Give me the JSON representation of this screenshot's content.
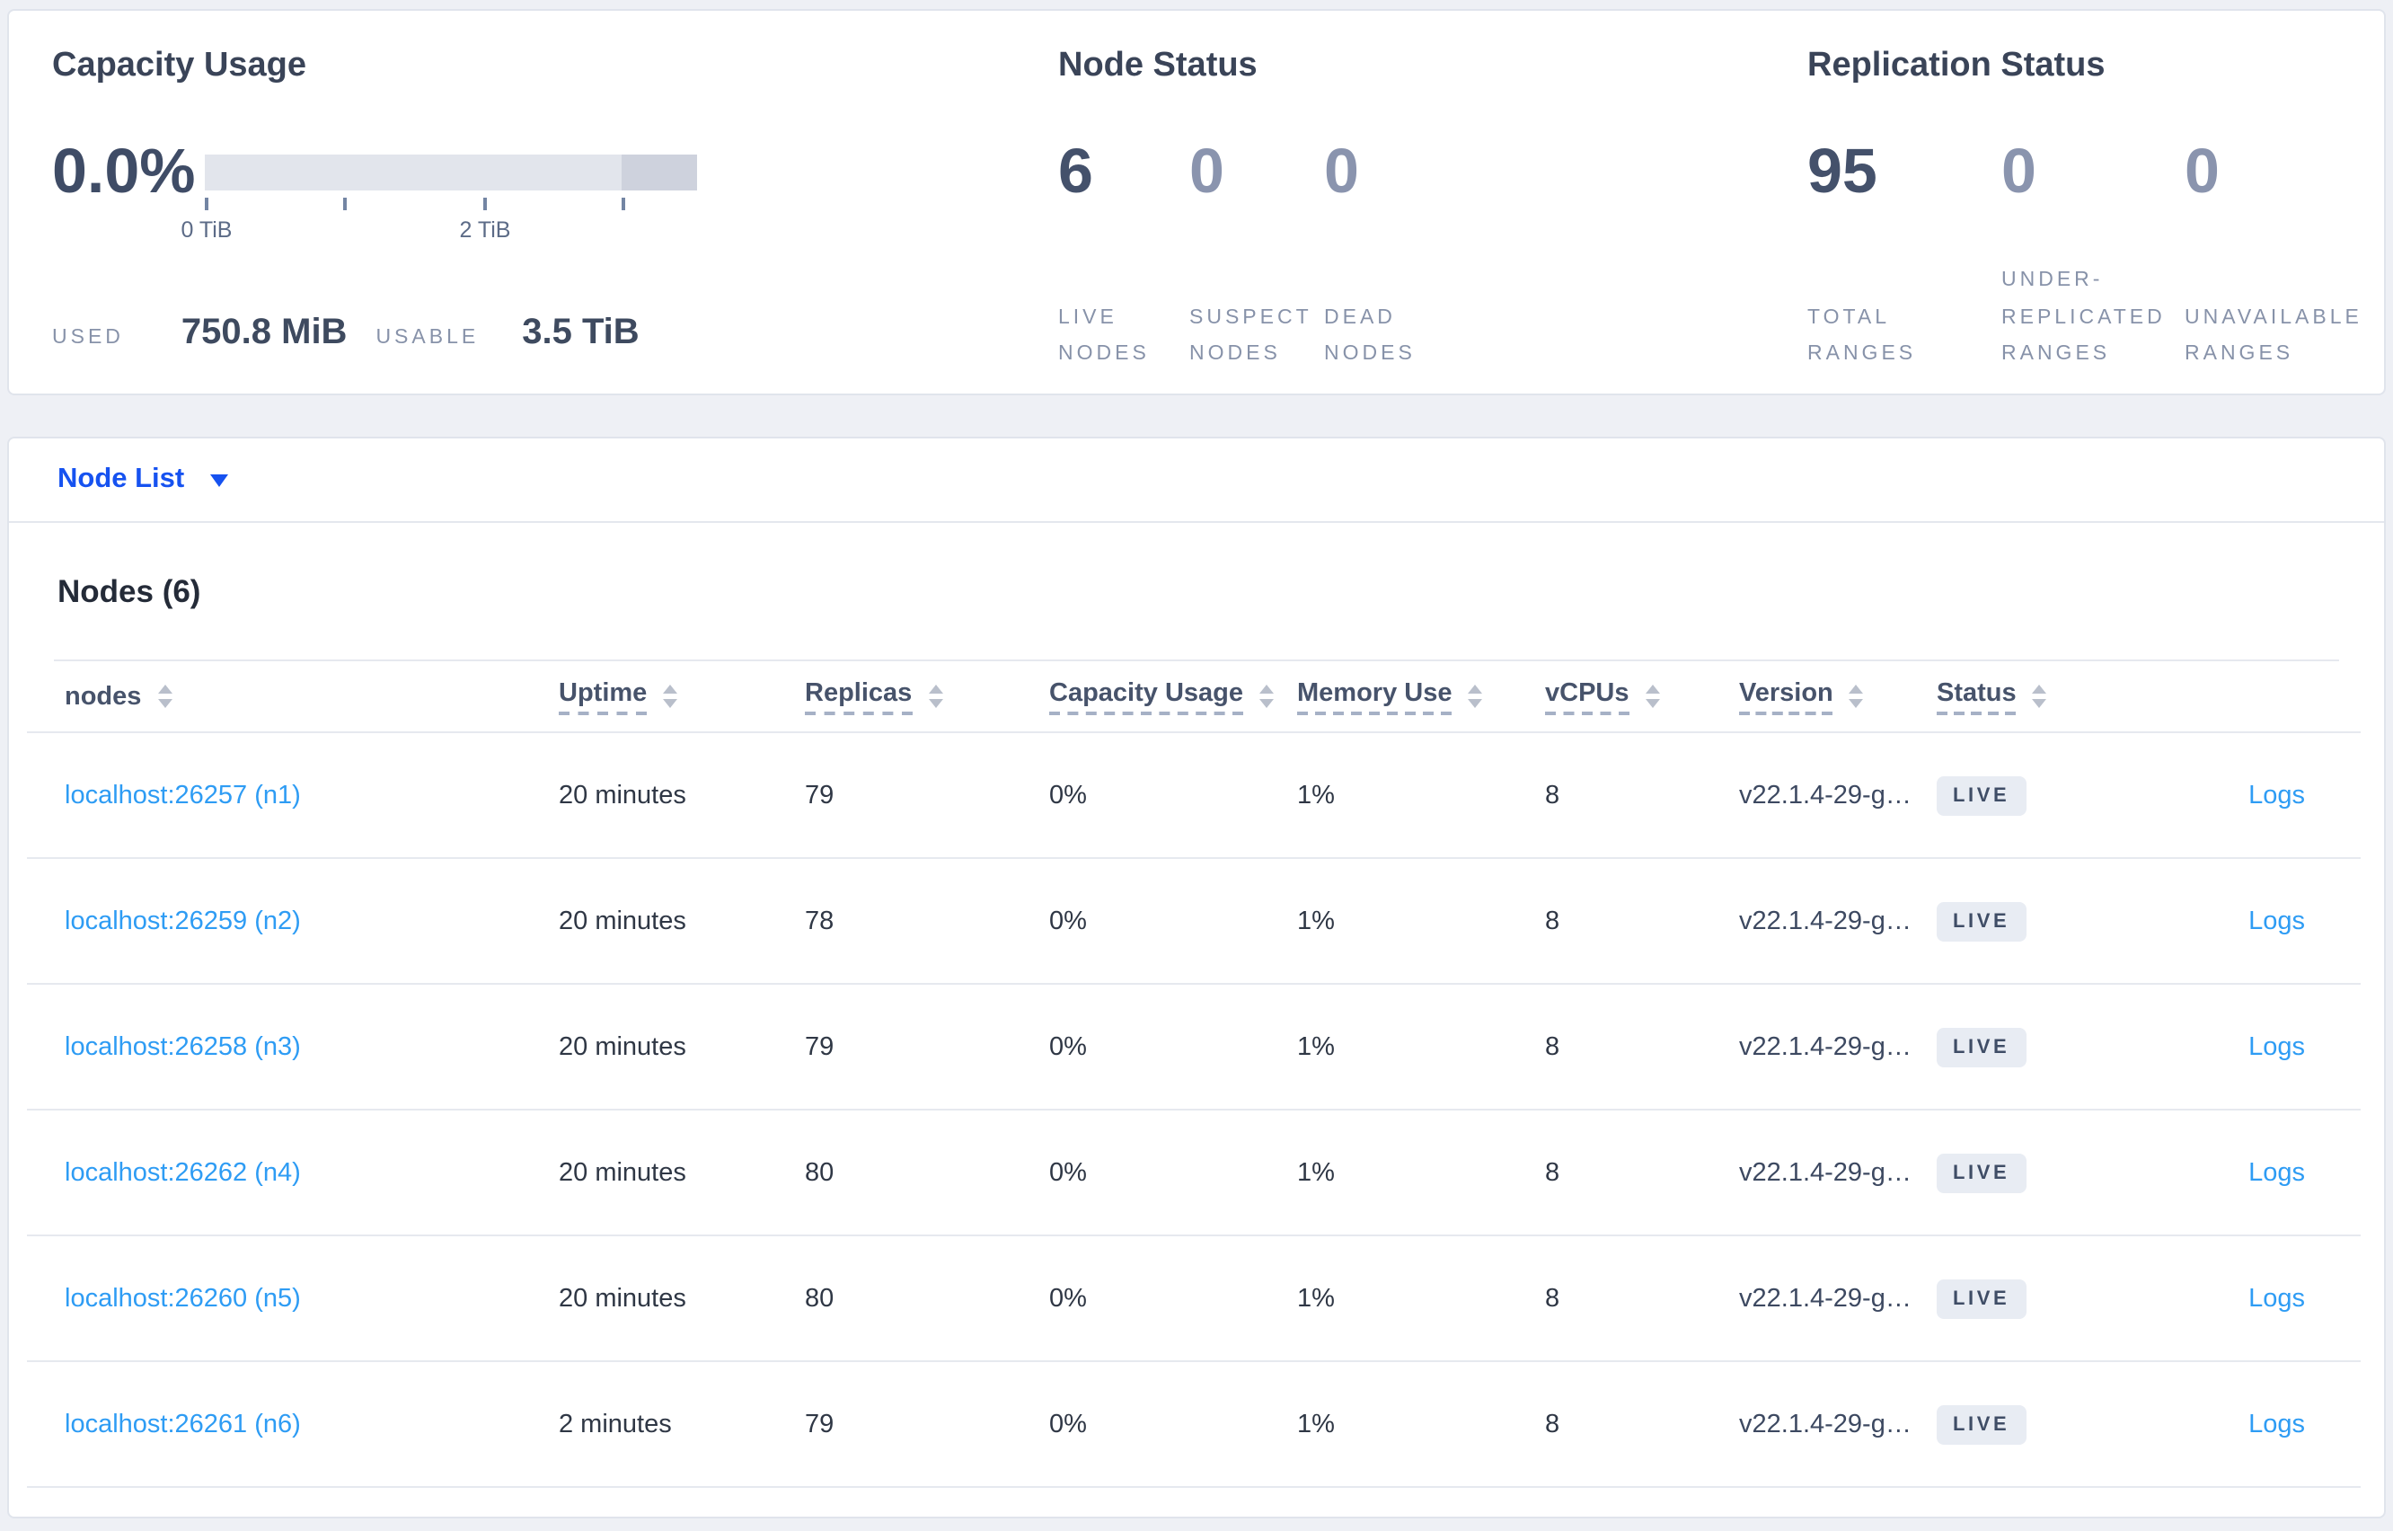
{
  "colors": {
    "selector_link_blue": "#1652f0",
    "row_link_blue": "#2e9cf4",
    "badge_bg": "#e8ecf3",
    "bar_fill_light": "#e2e5ec",
    "bar_fill_dark": "#ced2dd"
  },
  "summary": {
    "capacity": {
      "title": "Capacity Usage",
      "percent": "0.0%",
      "tick_labels": [
        "0 TiB",
        "2 TiB"
      ],
      "used_label": "USED",
      "used_value": "750.8 MiB",
      "usable_label": "USABLE",
      "usable_value": "3.5 TiB"
    },
    "node_status": {
      "title": "Node Status",
      "stats": [
        {
          "value": "6",
          "label": "LIVE NODES"
        },
        {
          "value": "0",
          "label": "SUSPECT NODES"
        },
        {
          "value": "0",
          "label": "DEAD NODES"
        }
      ]
    },
    "replication": {
      "title": "Replication Status",
      "stats": [
        {
          "value": "95",
          "label": "TOTAL RANGES"
        },
        {
          "value": "0",
          "label": "UNDER-REPLICATED RANGES"
        },
        {
          "value": "0",
          "label": "UNAVAILABLE RANGES"
        }
      ]
    }
  },
  "view_selector": {
    "label": "Node List"
  },
  "table": {
    "title": "Nodes (6)",
    "columns": [
      {
        "label": "nodes"
      },
      {
        "label": "Uptime"
      },
      {
        "label": "Replicas"
      },
      {
        "label": "Capacity Usage"
      },
      {
        "label": "Memory Use"
      },
      {
        "label": "vCPUs"
      },
      {
        "label": "Version"
      },
      {
        "label": "Status"
      }
    ],
    "rows": [
      {
        "address": "localhost:26257 (n1)",
        "uptime": "20 minutes",
        "replicas": "79",
        "capacity": "0%",
        "memory": "1%",
        "vcpus": "8",
        "version": "v22.1.4-29-g…",
        "status": "LIVE",
        "logs": "Logs"
      },
      {
        "address": "localhost:26259 (n2)",
        "uptime": "20 minutes",
        "replicas": "78",
        "capacity": "0%",
        "memory": "1%",
        "vcpus": "8",
        "version": "v22.1.4-29-g…",
        "status": "LIVE",
        "logs": "Logs"
      },
      {
        "address": "localhost:26258 (n3)",
        "uptime": "20 minutes",
        "replicas": "79",
        "capacity": "0%",
        "memory": "1%",
        "vcpus": "8",
        "version": "v22.1.4-29-g…",
        "status": "LIVE",
        "logs": "Logs"
      },
      {
        "address": "localhost:26262 (n4)",
        "uptime": "20 minutes",
        "replicas": "80",
        "capacity": "0%",
        "memory": "1%",
        "vcpus": "8",
        "version": "v22.1.4-29-g…",
        "status": "LIVE",
        "logs": "Logs"
      },
      {
        "address": "localhost:26260 (n5)",
        "uptime": "20 minutes",
        "replicas": "80",
        "capacity": "0%",
        "memory": "1%",
        "vcpus": "8",
        "version": "v22.1.4-29-g…",
        "status": "LIVE",
        "logs": "Logs"
      },
      {
        "address": "localhost:26261 (n6)",
        "uptime": "2 minutes",
        "replicas": "79",
        "capacity": "0%",
        "memory": "1%",
        "vcpus": "8",
        "version": "v22.1.4-29-g…",
        "status": "LIVE",
        "logs": "Logs"
      }
    ]
  }
}
